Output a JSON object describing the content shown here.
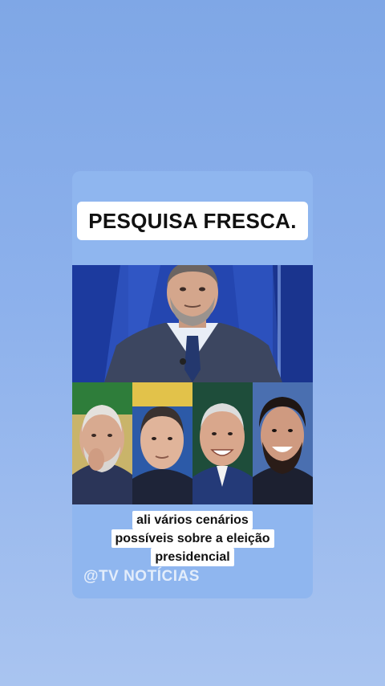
{
  "post": {
    "title": "PESQUISA FRESCA.",
    "caption_lines": [
      "ali vários cenários",
      "possíveis sobre a eleição",
      "presidencial"
    ],
    "watermark": "@TV NOTÍCIAS"
  },
  "colors": {
    "background_top": "#7fa7e6",
    "background_bottom": "#a9c4f0",
    "card": "#8fb6ef",
    "studio_blue": "#2f56c8"
  },
  "images": [
    {
      "name": "news-anchor-photo"
    },
    {
      "name": "candidate-photo-1"
    },
    {
      "name": "candidate-photo-2"
    },
    {
      "name": "candidate-photo-3"
    },
    {
      "name": "candidate-photo-4"
    }
  ]
}
